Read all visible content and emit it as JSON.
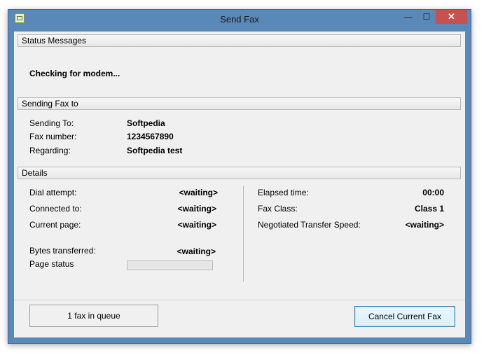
{
  "window": {
    "title": "Send Fax",
    "minimize_symbol": "—",
    "maximize_symbol": "☐",
    "close_symbol": "✕",
    "app_icon": "fax-icon"
  },
  "status": {
    "header": "Status Messages",
    "message": "Checking for modem..."
  },
  "sending": {
    "header": "Sending Fax to",
    "rows": [
      {
        "label": "Sending To:",
        "value": "Softpedia"
      },
      {
        "label": "Fax number:",
        "value": "1234567890"
      },
      {
        "label": "Regarding:",
        "value": "Softpedia test"
      }
    ]
  },
  "details": {
    "header": "Details",
    "left": [
      {
        "label": "Dial attempt:",
        "value": "<waiting>"
      },
      {
        "label": "Connected to:",
        "value": "<waiting>"
      },
      {
        "label": "Current page:",
        "value": "<waiting>"
      },
      {
        "label": "Bytes transferred:",
        "value": "<waiting>"
      },
      {
        "label": "Page status",
        "progress": 0
      }
    ],
    "right": [
      {
        "label": "Elapsed time:",
        "value": "00:00"
      },
      {
        "label": "Fax Class:",
        "value": "Class 1"
      },
      {
        "label": "Negotiated Transfer Speed:",
        "value": "<waiting>"
      }
    ]
  },
  "footer": {
    "queue_text": "1 fax in queue",
    "cancel_label": "Cancel Current Fax"
  },
  "colors": {
    "frame": "#5a88b8",
    "close_button": "#c75050",
    "client_bg": "#f0f0f0",
    "button_border": "#3c7fb1"
  }
}
